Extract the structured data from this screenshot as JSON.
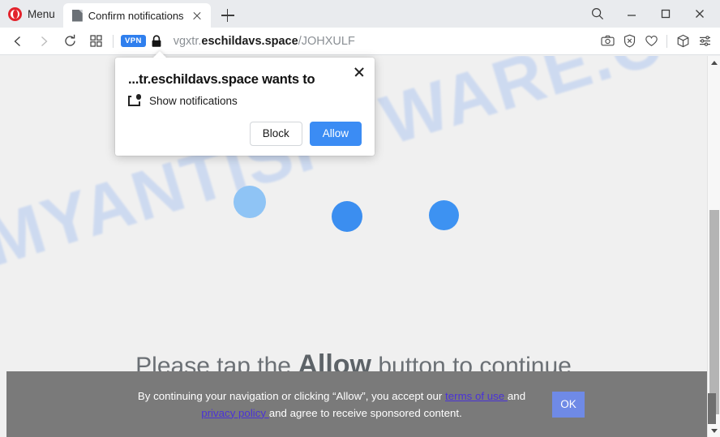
{
  "browser": {
    "menu_label": "Menu",
    "tab": {
      "title": "Confirm notifications",
      "favicon": "page-icon",
      "close_icon": "close-icon"
    },
    "new_tab_icon": "plus-icon",
    "window_controls": [
      {
        "name": "search",
        "icon": "search-icon"
      },
      {
        "name": "minimize",
        "icon": "minimize-icon"
      },
      {
        "name": "maximize",
        "icon": "maximize-icon"
      },
      {
        "name": "close",
        "icon": "close-icon"
      }
    ],
    "nav": {
      "back_icon": "chevron-left-icon",
      "forward_icon": "chevron-right-icon",
      "reload_icon": "reload-icon",
      "speeddial_icon": "grid-icon",
      "vpn_badge": "VPN",
      "lock_icon": "lock-icon",
      "url": {
        "prefix": "vgxtr.",
        "host": "eschildavs.space",
        "path": "/JOHXULF",
        "full": "vgxtr.eschildavs.space/JOHXULF"
      },
      "right_icons": [
        {
          "name": "snapshot",
          "icon": "camera-icon"
        },
        {
          "name": "ad-blocker",
          "icon": "shield-x-icon"
        },
        {
          "name": "favorites",
          "icon": "heart-icon"
        },
        {
          "name": "extensions",
          "icon": "cube-icon"
        },
        {
          "name": "easy-setup",
          "icon": "sliders-icon"
        }
      ]
    }
  },
  "permission_dialog": {
    "title": "...tr.eschildavs.space wants to",
    "permission_icon": "notification-permission-icon",
    "permission_label": "Show notifications",
    "block_label": "Block",
    "allow_label": "Allow",
    "close_icon": "close-icon"
  },
  "page": {
    "watermark": "MYANTISPYWARE.COM",
    "dots": [
      {
        "color": "#8fc4f5"
      },
      {
        "color": "#3b8ef0"
      },
      {
        "color": "#3d92f2"
      }
    ],
    "tap_line": {
      "before": "Please tap the ",
      "emphasis": "Allow",
      "after": " button to continue"
    },
    "banner": {
      "text_part1": "By continuing your navigation or clicking “Allow”, you accept our ",
      "link1": "terms of use ",
      "text_part2": "and ",
      "link2": "privacy policy ",
      "text_part3": "and agree to receive sponsored content.",
      "ok_label": "OK",
      "background": "#7a7a7a",
      "button_color": "#6f8ae6",
      "link_color": "#4a32d8"
    }
  },
  "scrollbar": {
    "up_icon": "scroll-up-icon",
    "down_icon": "scroll-down-icon"
  }
}
